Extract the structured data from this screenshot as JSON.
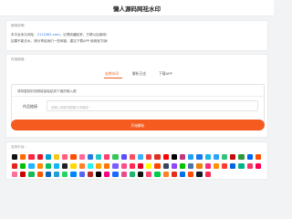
{
  "header": {
    "title": "懒人源码网祛水印"
  },
  "notice": {
    "label": "使用说明:",
    "line1_prefix": "本平台永久网址：",
    "line1_domain": "2112361.com",
    "line1_suffix": "，记得收藏起来，方便以后使用!",
    "line2": "如果不能去水，请分享给我们一些网链，建议下载APP 使用官方版!"
  },
  "online": {
    "label": "在线使用:",
    "tabs": [
      "去除水印",
      "解析日志",
      "下载APP"
    ],
    "active_tab": 0,
    "hint": "请将复制的视频链接粘贴到下面的输入框",
    "field_label": "作品链接",
    "field_placeholder": "请输入视频或图集分享链接~",
    "submit_label": "开始解析"
  },
  "platforms": {
    "label": "支持平台:",
    "icons": [
      {
        "name": "douyin-icon",
        "color": "#111111"
      },
      {
        "name": "kuaishou-icon",
        "color": "#ff6a00"
      },
      {
        "name": "xiaohongshu-icon",
        "color": "#ff2442"
      },
      {
        "name": "weibo-icon",
        "color": "#e6162d"
      },
      {
        "name": "bilibili-icon",
        "color": "#00a1d6"
      },
      {
        "name": "xigua-icon",
        "color": "#f5c518"
      },
      {
        "name": "pipixia-icon",
        "color": "#ff5e7c"
      },
      {
        "name": "huoshan-icon",
        "color": "#ff4d00"
      },
      {
        "name": "weishi-icon",
        "color": "#ff6699"
      },
      {
        "name": "haokan-icon",
        "color": "#2a7ae2"
      },
      {
        "name": "zuiyou-icon",
        "color": "#23c7c7"
      },
      {
        "name": "meipai-icon",
        "color": "#ff3d6e"
      },
      {
        "name": "lvzhou-icon",
        "color": "#34c759"
      },
      {
        "name": "quanmin-icon",
        "color": "#5b4cff"
      },
      {
        "name": "acfun-icon",
        "color": "#fd4c5d"
      },
      {
        "name": "momo-icon",
        "color": "#3ab0ff"
      },
      {
        "name": "toutiao-icon",
        "color": "#f04142"
      },
      {
        "name": "pinduoduo-icon",
        "color": "#e02e24"
      },
      {
        "name": "youtube-icon",
        "color": "#ff0000"
      },
      {
        "name": "tiktok-icon",
        "color": "#000000"
      },
      {
        "name": "instagram-icon",
        "color": "#c13584"
      },
      {
        "name": "twitter-icon",
        "color": "#1da1f2"
      },
      {
        "name": "facebook-icon",
        "color": "#1877f2"
      },
      {
        "name": "vimeo-icon",
        "color": "#1ab7ea"
      },
      {
        "name": "kugou-icon",
        "color": "#2ca2f9"
      },
      {
        "name": "qqmusic-icon",
        "color": "#31c27c"
      },
      {
        "name": "netease-icon",
        "color": "#c20c0c"
      },
      {
        "name": "douban-icon",
        "color": "#2e963d"
      },
      {
        "name": "zhihu-icon",
        "color": "#0066ff"
      },
      {
        "name": "taobao-icon",
        "color": "#ff5000"
      },
      {
        "name": "jd-icon",
        "color": "#e1251b"
      },
      {
        "name": "iqiyi-icon",
        "color": "#00be06"
      },
      {
        "name": "youku-icon",
        "color": "#1eb4ff"
      },
      {
        "name": "mangguo-icon",
        "color": "#ff8a00"
      },
      {
        "name": "weixin-icon",
        "color": "#07c160"
      },
      {
        "name": "qq-icon",
        "color": "#12b7f5"
      },
      {
        "name": "dewu-icon",
        "color": "#222222"
      },
      {
        "name": "xianyu-icon",
        "color": "#ffda00"
      },
      {
        "name": "kuaishou-lite-icon",
        "color": "#ff7f24"
      },
      {
        "name": "douyin-lite-icon",
        "color": "#25f4ee"
      },
      {
        "name": "huya-icon",
        "color": "#ffa200"
      },
      {
        "name": "douyu-icon",
        "color": "#ff7700"
      },
      {
        "name": "zuiyou-alt-icon",
        "color": "#7c5cff"
      },
      {
        "name": "meitu-icon",
        "color": "#ff4f8b"
      },
      {
        "name": "tiktok-lite-icon",
        "color": "#fe2c55"
      },
      {
        "name": "pinterest-icon",
        "color": "#e60023"
      },
      {
        "name": "snapchat-icon",
        "color": "#fffc00"
      },
      {
        "name": "reddit-icon",
        "color": "#ff4500"
      },
      {
        "name": "tumblr-icon",
        "color": "#36465d"
      },
      {
        "name": "twitch-icon",
        "color": "#9146ff"
      },
      {
        "name": "line-icon",
        "color": "#00c300"
      },
      {
        "name": "vk-icon",
        "color": "#4c75a3"
      },
      {
        "name": "ok-icon",
        "color": "#ee8208"
      },
      {
        "name": "likee-icon",
        "color": "#ff2d78"
      },
      {
        "name": "kwai-icon",
        "color": "#ff9000"
      },
      {
        "name": "triller-icon",
        "color": "#ff3b30"
      },
      {
        "name": "dailymotion-icon",
        "color": "#0066dc"
      },
      {
        "name": "vine-icon",
        "color": "#00b488"
      },
      {
        "name": "weishi-alt-icon",
        "color": "#ff3366"
      },
      {
        "name": "douyin-hot-icon",
        "color": "#ff0050"
      },
      {
        "name": "bilibili-alt-icon",
        "color": "#fb7299"
      },
      {
        "name": "youtube-music-icon",
        "color": "#cc0000"
      },
      {
        "name": "spotify-icon",
        "color": "#1db954"
      },
      {
        "name": "soundcloud-icon",
        "color": "#ff5500"
      },
      {
        "name": "linkedin-icon",
        "color": "#0a66c2"
      },
      {
        "name": "telegram-icon",
        "color": "#229ed9"
      },
      {
        "name": "whatsapp-icon",
        "color": "#25d366"
      },
      {
        "name": "messenger-icon",
        "color": "#0084ff"
      },
      {
        "name": "discord-icon",
        "color": "#5865f2"
      },
      {
        "name": "quora-icon",
        "color": "#b92b27"
      },
      {
        "name": "medium-icon",
        "color": "#000000"
      },
      {
        "name": "flickr-icon",
        "color": "#ff0084"
      },
      {
        "name": "behance-icon",
        "color": "#1769ff"
      },
      {
        "name": "dribbble-icon",
        "color": "#ea4c89"
      },
      {
        "name": "imgur-icon",
        "color": "#1bb76e"
      },
      {
        "name": "9gag-icon",
        "color": "#111111"
      },
      {
        "name": "weheartit-icon",
        "color": "#ff4477"
      },
      {
        "name": "deviantart-icon",
        "color": "#05cc47"
      },
      {
        "name": "mix-icon",
        "color": "#ff8226"
      },
      {
        "name": "ted-icon",
        "color": "#e62b1e"
      },
      {
        "name": "zhihu-alt-icon",
        "color": "#056de8"
      },
      {
        "name": "kuaishou-alt-icon",
        "color": "#ff4906"
      },
      {
        "name": "douyin-alt-icon",
        "color": "#161823"
      },
      {
        "name": "xhs-alt-icon",
        "color": "#fe2c55"
      }
    ]
  }
}
